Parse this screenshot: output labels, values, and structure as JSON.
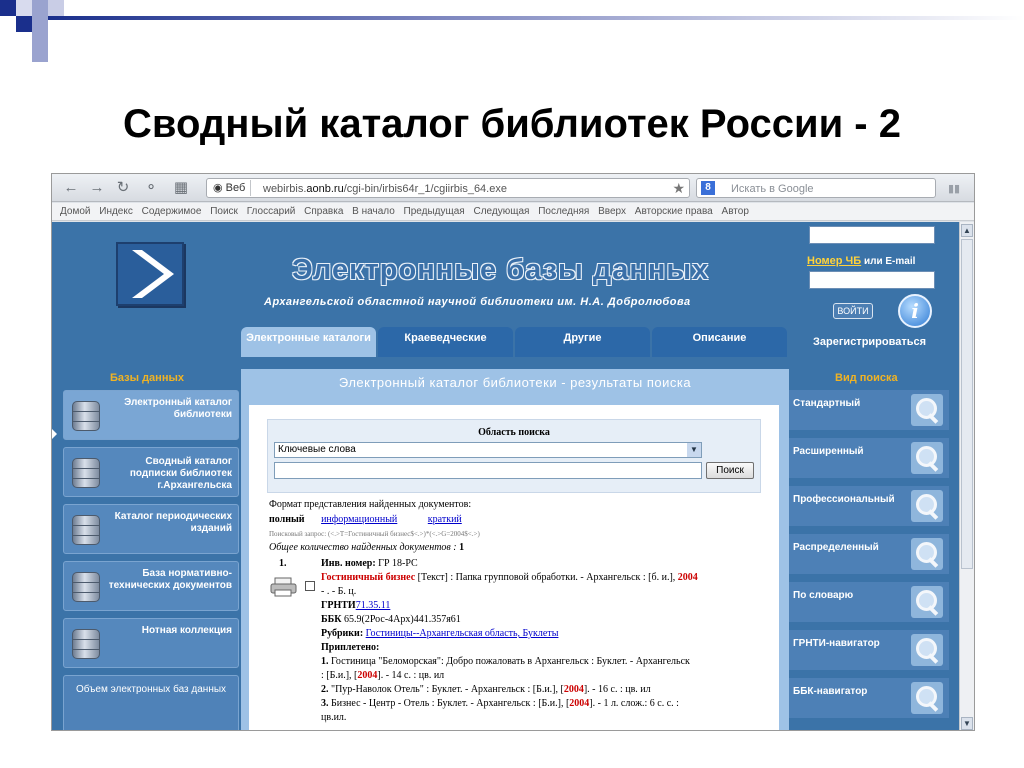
{
  "slide": {
    "title": "Сводный каталог библиотек России - 2"
  },
  "browser": {
    "address_prefix": "Веб",
    "url_pre": "webirbis.",
    "url_host": "aonb.ru",
    "url_path": "/cgi-bin/irbis64r_1/cgiirbis_64.exe",
    "search_placeholder": "Искать в Google",
    "linkbar": [
      "Домой",
      "Индекс",
      "Содержимое",
      "Поиск",
      "Глоссарий",
      "Справка",
      "В начало",
      "Предыдущая",
      "Следующая",
      "Последняя",
      "Вверх",
      "Авторские права",
      "Автор"
    ]
  },
  "banner": {
    "title": "Электронные базы данных",
    "subtitle": "Архангельской областной научной библиотеки им. Н.А. Добролюбова"
  },
  "login": {
    "label_link": "Номер ЧБ",
    "label_rest": " или E-mail",
    "enter": "ВОЙТИ",
    "register": "Зарегистрироваться"
  },
  "tabs": [
    {
      "label": "Электронные каталоги"
    },
    {
      "label": "Краеведческие"
    },
    {
      "label": "Другие"
    },
    {
      "label": "Описание"
    }
  ],
  "left": {
    "heading": "Базы данных",
    "items": [
      "Электронный каталог библиотеки",
      "Сводный каталог подписки библиотек г.Архангельска",
      "Каталог периодических изданий",
      "База нормативно-технических документов",
      "Нотная коллекция"
    ],
    "stats": "Объем электронных баз данных"
  },
  "right": {
    "heading": "Вид поиска",
    "items": [
      "Стандартный",
      "Расширенный",
      "Профессиональный",
      "Распределенный",
      "По словарю",
      "ГРНТИ-навигатор",
      "ББК-навигатор"
    ]
  },
  "main": {
    "heading": "Электронный каталог библиотеки - результаты поиска",
    "search_area_title": "Область поиска",
    "select_value": "Ключевые слова",
    "search_button": "Поиск",
    "format_label": "Формат представления найденных документов:",
    "format_full": "полный",
    "format_info": "информационный",
    "format_short": "краткий",
    "query": "Поисковый запрос: (<.>T=Гостиничный бизнес$<.>)*(<.>G=2004$<.>)",
    "total_label": "Общее количество найденных документов",
    "total_count": "1",
    "rec_num": "1.",
    "inv_label": "Инв. номер:",
    "inv_value": "ГР 18-РС",
    "rec_title": "Гостиничный бизнес",
    "rec_desc": "[Текст] : Папка групповой обработки. - Архангельск : [б. и.],",
    "rec_year": "2004",
    "rec_desc2": "- . - Б. ц.",
    "grnti_label": "ГРНТИ",
    "grnti_value": "71.35.11",
    "bbk_label": "ББК",
    "bbk_value": "65.9(2Рос-4Арх)441.357я61",
    "rubrics_label": "Рубрики:",
    "rubrics_value": "Гостиницы--Архангельская область, Буклеты",
    "attached_label": "Приплетено:",
    "att1a": "Гостиница \"Беломорская\": Добро пожаловать в Архангельск : Буклет. - Архангельск",
    "att1b": ": [Б.и.], [",
    "att1c": "]. - 14 с. : цв. ил",
    "att2a": "\"Пур-Наволок Отель\" : Буклет. - Архангельск : [Б.и.], [",
    "att2b": "]. - 16 с. : цв. ил",
    "att3a": "Бизнес - Центр - Отель : Буклет. - Архангельск : [Б.и.], [",
    "att3b": "]. - 1 л. слож.: 6 с. с. :",
    "att3c": "цв.ил."
  }
}
